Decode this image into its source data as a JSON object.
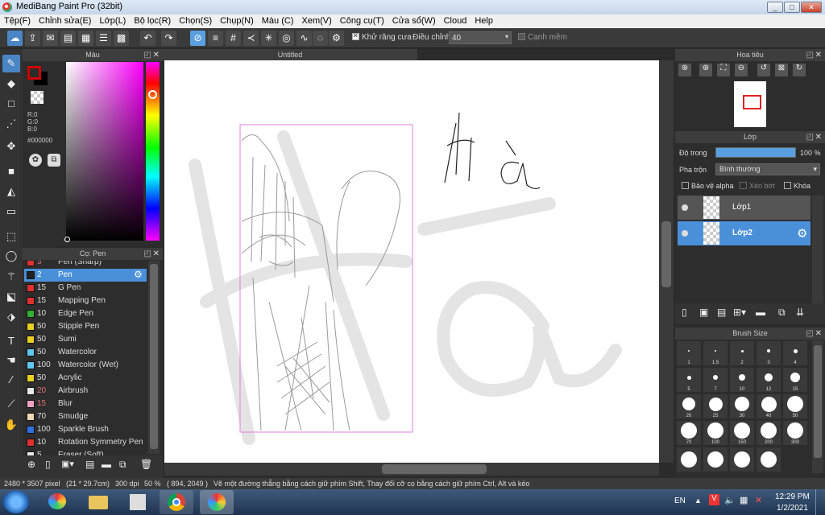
{
  "window": {
    "title": "MediBang Paint Pro (32bit)",
    "min": "_",
    "max": "□",
    "close": "✕"
  },
  "menu": [
    "Tệp(F)",
    "Chỉnh sửa(E)",
    "Lớp(L)",
    "Bộ lọc(R)",
    "Chọn(S)",
    "Chụp(N)",
    "Màu (C)",
    "Xem(V)",
    "Công cụ(T)",
    "Cửa sổ(W)",
    "Cloud",
    "Help"
  ],
  "toolbar": {
    "antialias_label": "Khử răng cưa",
    "adjust_label": "Điều chỉnh",
    "adjust_value": "40",
    "soft_edge_label": "Cạnh mềm"
  },
  "color_panel": {
    "title": "Màu",
    "rgb": [
      "R:0",
      "G:0",
      "B:0"
    ],
    "hex": "#000000",
    "primary_color": "#cc0000",
    "secondary_color": "#000000"
  },
  "brush_panel": {
    "title": "Cọ: Pen",
    "items": [
      {
        "size": "3",
        "name": "Pen (Sharp)",
        "color": "#e03030"
      },
      {
        "size": "2",
        "name": "Pen",
        "color": "#222222",
        "selected": true
      },
      {
        "size": "15",
        "name": "G Pen",
        "color": "#e03030"
      },
      {
        "size": "15",
        "name": "Mapping Pen",
        "color": "#e03030"
      },
      {
        "size": "10",
        "name": "Edge Pen",
        "color": "#30b030"
      },
      {
        "size": "50",
        "name": "Stipple Pen",
        "color": "#e8d020"
      },
      {
        "size": "50",
        "name": "Sumi",
        "color": "#e8d020"
      },
      {
        "size": "50",
        "name": "Watercolor",
        "color": "#60c8f0"
      },
      {
        "size": "100",
        "name": "Watercolor (Wet)",
        "color": "#60c8f0"
      },
      {
        "size": "50",
        "name": "Acrylic",
        "color": "#e8d020"
      },
      {
        "size": "20",
        "name": "Airbrush",
        "color": "#e8e8e8"
      },
      {
        "size": "15",
        "name": "Blur",
        "color": "#f0a0c0"
      },
      {
        "size": "70",
        "name": "Smudge",
        "color": "#f0d8b0"
      },
      {
        "size": "100",
        "name": "Sparkle Brush",
        "color": "#3070e0"
      },
      {
        "size": "10",
        "name": "Rotation Symmetry Pen",
        "color": "#e03030"
      },
      {
        "size": "5",
        "name": "Eraser (Soft)",
        "color": "#e8e8e8"
      }
    ]
  },
  "canvas": {
    "tab_title": "Untitled",
    "handwriting": "Hà"
  },
  "navigator": {
    "title": "Hoa tiêu"
  },
  "layer_panel": {
    "title": "Lớp",
    "opacity_label": "Độ trong",
    "opacity_value": "100 %",
    "opacity": 1.0,
    "blend_label": "Pha trộn",
    "blend_value": "Bình thường",
    "protect_alpha": "Bảo vệ alpha",
    "clipping": "Xén bớt",
    "lock": "Khóa",
    "layers": [
      {
        "name": "Lớp1",
        "selected": false
      },
      {
        "name": "Lớp2",
        "selected": true
      }
    ]
  },
  "brush_size_panel": {
    "title": "Brush Size",
    "sizes": [
      "1",
      "1.5",
      "2",
      "3",
      "4",
      "5",
      "7",
      "10",
      "12",
      "15",
      "20",
      "25",
      "30",
      "40",
      "50",
      "70",
      "100",
      "150",
      "200",
      "300",
      "",
      "",
      "",
      ""
    ]
  },
  "status": {
    "dimensions": "2480 * 3507 pixel",
    "physical": "(21 * 29.7cm)",
    "dpi": "300 dpi",
    "zoom": "50 %",
    "coords": "( 894, 2049 )",
    "hint": "Vẽ một đường thẳng bằng cách giữ phím Shift, Thay đổi cỡ cọ bằng cách giữ phím Ctrl, Alt và kéo"
  },
  "taskbar": {
    "lang": "EN",
    "time": "12:29 PM",
    "date": "1/2/2021"
  }
}
